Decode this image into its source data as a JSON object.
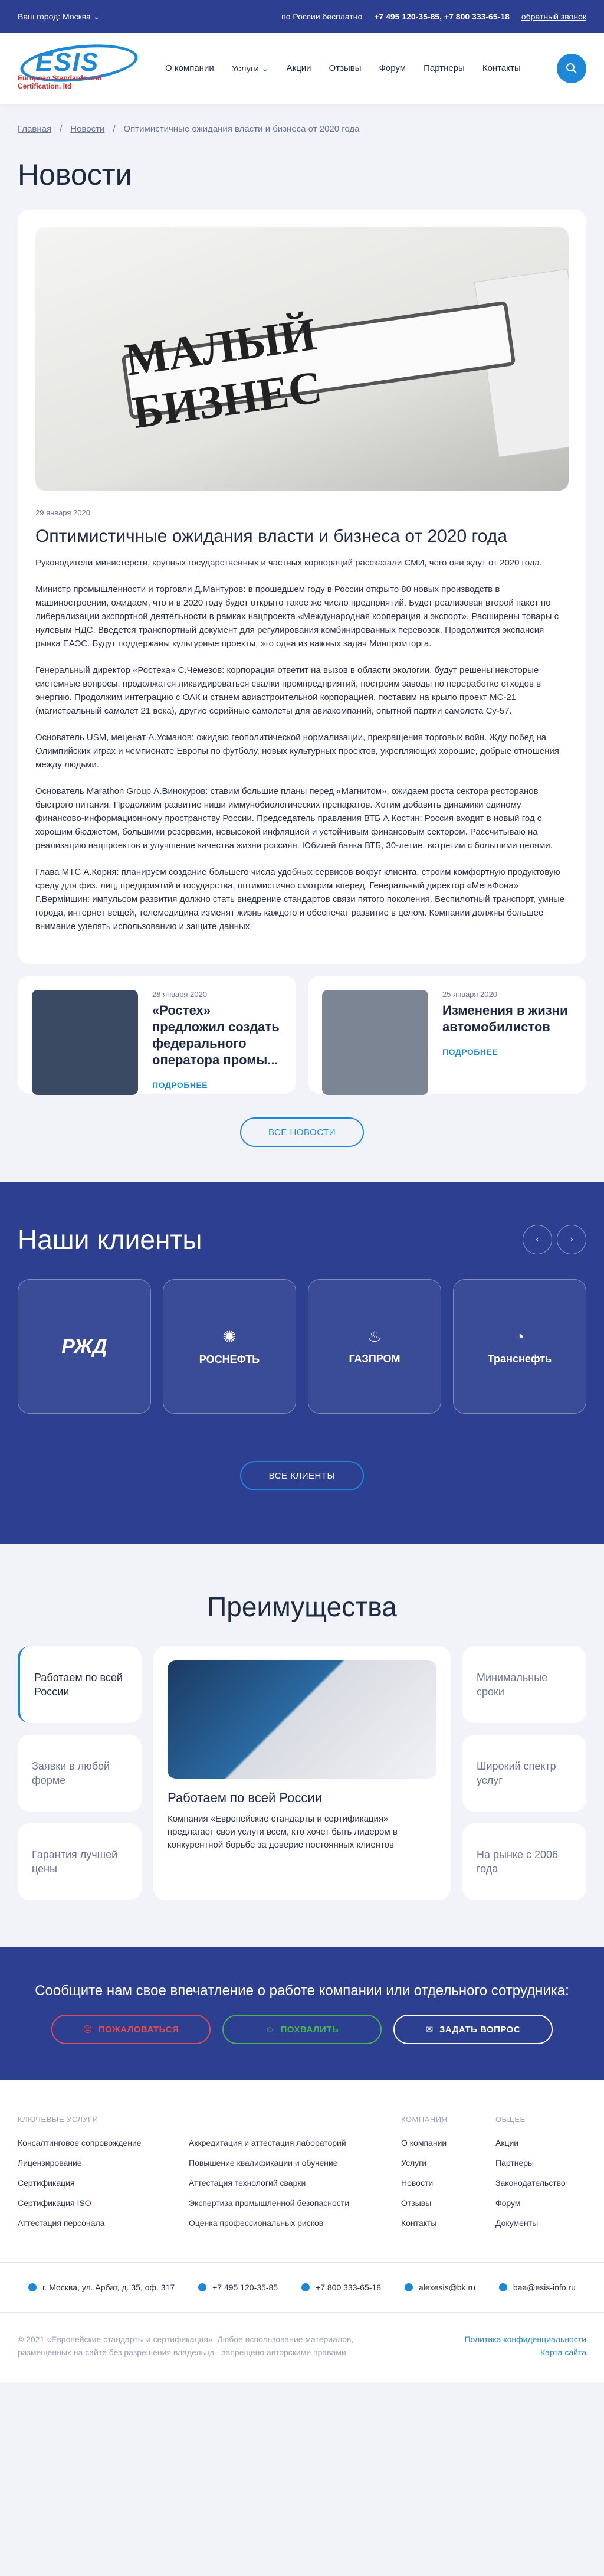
{
  "topbar": {
    "city": "Ваш город: Москва",
    "free": "по России бесплатно",
    "phones": "+7 495 120-35-85, +7 800 333-65-18",
    "callback": "обратный звонок"
  },
  "logo": {
    "big": "ESIS",
    "sub": "European Standards and Certification, ltd"
  },
  "nav": [
    "О компании",
    "Услуги",
    "Акции",
    "Отзывы",
    "Форум",
    "Партнеры",
    "Контакты"
  ],
  "crumbs": {
    "home": "Главная",
    "news": "Новости",
    "current": "Оптимистичные ожидания власти и бизнеса от 2020 года"
  },
  "page_title": "Новости",
  "article": {
    "hero_text": "МАЛЫЙ БИЗНЕС",
    "date": "29 января 2020",
    "title": "Оптимистичные ожидания власти и бизнеса от 2020 года",
    "p": [
      "Руководители министерств, крупных государственных и частных корпораций рассказали СМИ, чего они ждут от 2020 года.",
      "Министр промышленности и торговли Д.Мантуров: в прошедшем году в России открыто 80 новых производств в машиностроении, ожидаем, что и в 2020 году будет открыто такое же число предприятий. Будет реализован второй пакет по либерализации экспортной деятельности в рамках нацпроекта «Международная кооперация и экспорт». Расширены товары с нулевым НДС. Введется транспортный документ для регулирования комбинированных перевозок. Продолжится экспансия рынка ЕАЭС. Будут поддержаны культурные проекты, это одна из важных задач Минпромторга.",
      "Генеральный директор «Ростеха» С.Чемезов: корпорация ответит на вызов в области экологии, будут решены некоторые системные вопросы, продолжатся ликвидироваться свалки промпредприятий, построим заводы по переработке отходов в энергию. Продолжим интеграцию с ОАК и станем авиастроительной корпорацией, поставим на крыло проект МС-21 (магистральный самолет 21 века), другие серийные самолеты для авиакомпаний, опытной партии самолета Су-57.",
      "Основатель USM, меценат А.Усманов: ожидаю геополитической нормализации, прекращения торговых войн. Жду побед на Олимпийских играх и чемпионате Европы по футболу, новых культурных проектов, укрепляющих хорошие, добрые отношения между людьми.",
      "Основатель Marathon Group А.Винокуров: ставим большие планы перед «Магнитом», ожидаем роста сектора ресторанов быстрого питания. Продолжим развитие ниши иммунобиологических препаратов. Хотим добавить динамики единому финансово-информационному пространству России. Председатель правления ВТБ А.Костин: Россия входит в новый год с хорошим бюджетом, большими резервами, невысокой инфляцией и устойчивым финансовым сектором. Рассчитываю на реализацию нацпроектов и улучшение качества жизни россиян. Юбилей банка ВТБ, 30-летие, встретим с большими целями.",
      "Глава МТС А.Корня: планируем создание большего числа удобных сервисов вокруг клиента, строим комфортную продуктовую среду для физ. лиц, предприятий и государства, оптимистично смотрим вперед. Генеральный директор «МегаФона» Г.Верміишин: импульсом развития должно стать внедрение стандартов связи пятого поколения. Беспилотный транспорт, умные города, интернет вещей, телемедицина изменят жизнь каждого и обеспечат развитие в целом. Компании должны большее внимание уделять использованию и защите данных."
    ]
  },
  "related": [
    {
      "date": "28 января 2020",
      "title": "«Ростех» предложил создать федерального оператора промы...",
      "more": "ПОДРОБНЕЕ",
      "thumb": "#3a4a63"
    },
    {
      "date": "25 января 2020",
      "title": "Изменения в жизни автомобилистов",
      "more": "ПОДРОБНЕЕ",
      "thumb": "#7b8594"
    }
  ],
  "all_news": "ВСЕ НОВОСТИ",
  "clients": {
    "title": "Наши клиенты",
    "logos": [
      "РЖД",
      "РОСНЕФТЬ",
      "ГАЗПРОМ",
      "Транснефть"
    ],
    "all": "ВСЕ КЛИЕНТЫ"
  },
  "advantages": {
    "title": "Преимущества",
    "left": [
      "Работаем по всей России",
      "Заявки в любой форме",
      "Гарантия лучшей цены"
    ],
    "right": [
      "Минимальные сроки",
      "Широкий спектр услуг",
      "На рынке с 2006 года"
    ],
    "main_title": "Работаем по всей России",
    "main_text": "Компания «Европейские стандарты и сертификация» предлагает свои услуги всем, кто хочет быть лидером в конкурентной борьбе за доверие постоянных клиентов"
  },
  "feedback": {
    "title": "Сообщите нам свое впечатление о работе компании или отдельного сотрудника:",
    "complain": "ПОЖАЛОВАТЬСЯ",
    "praise": "ПОХВАЛИТЬ",
    "ask": "ЗАДАТЬ ВОПРОС"
  },
  "footer": {
    "h1": "КЛЮЧЕВЫЕ УСЛУГИ",
    "col1": [
      "Консалтинговое сопровождение",
      "Лицензирование",
      "Сертификация",
      "Сертификация ISO",
      "Аттестация персонала"
    ],
    "col2": [
      "Аккредитация и аттестация лабораторий",
      "Повышение квалификации и обучение",
      "Аттестация технологий сварки",
      "Экспертиза промышленной безопасности",
      "Оценка профессиональных рисков"
    ],
    "h3": "КОМПАНИЯ",
    "col3": [
      "О компании",
      "Услуги",
      "Новости",
      "Отзывы",
      "Контакты"
    ],
    "h4": "ОБЩЕЕ",
    "col4": [
      "Акции",
      "Партнеры",
      "Законодательство",
      "Форум",
      "Документы"
    ],
    "address": "г. Москва, ул. Арбат, д. 35, оф. 317",
    "phone1": "+7 495 120-35-85",
    "phone2": "+7 800 333-65-18",
    "email1": "alexesis@bk.ru",
    "email2": "baa@esis-info.ru",
    "copy": "© 2021 «Европейские стандарты и сертификация». Любое использование материалов, размещенных на сайте без разрешения владельца - запрещено авторскими правами",
    "privacy": "Политика конфиденциальности",
    "sitemap": "Карта сайта"
  }
}
